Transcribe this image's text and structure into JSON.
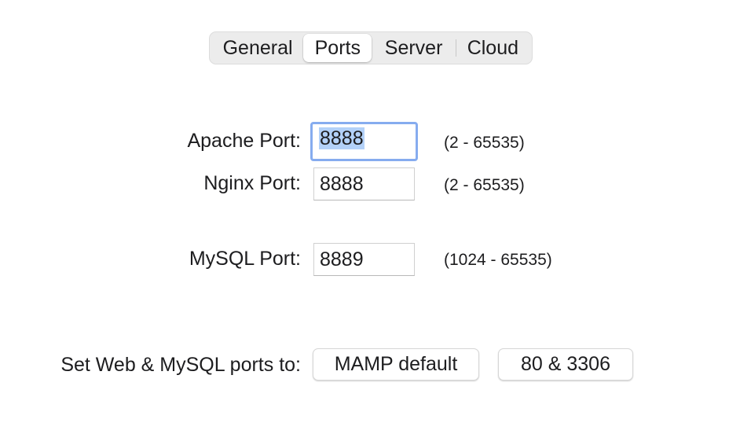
{
  "tabs": [
    {
      "label": "General",
      "selected": false
    },
    {
      "label": "Ports",
      "selected": true
    },
    {
      "label": "Server",
      "selected": false
    },
    {
      "label": "Cloud",
      "selected": false
    }
  ],
  "ports": {
    "apache": {
      "label": "Apache Port:",
      "value": "8888",
      "range": "(2 - 65535)",
      "focused": true
    },
    "nginx": {
      "label": "Nginx Port:",
      "value": "8888",
      "range": "(2 - 65535)"
    },
    "mysql": {
      "label": "MySQL Port:",
      "value": "8889",
      "range": "(1024 - 65535)"
    }
  },
  "presets": {
    "label": "Set Web & MySQL ports to:",
    "mamp_default": "MAMP default",
    "alt_ports": "80 & 3306"
  },
  "colors": {
    "focus_ring": "#86acef",
    "text_selection": "#b3d1f8",
    "segment_bg": "#ececec"
  }
}
